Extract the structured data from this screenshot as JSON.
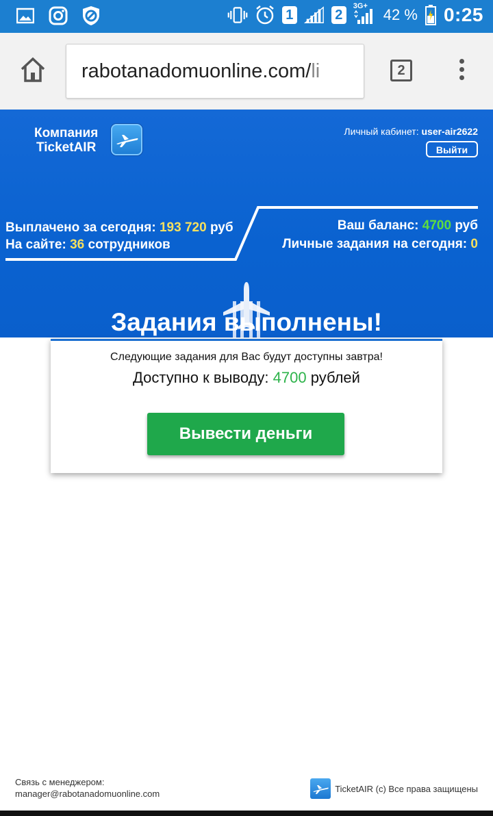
{
  "status_bar": {
    "battery_percent": "42 %",
    "time": "0:25",
    "sim1": "1",
    "sim2": "2",
    "network": "3G+",
    "icons": [
      "gallery-icon",
      "instagram-icon",
      "blocked-icon",
      "vibrate-icon",
      "alarm-icon",
      "signal-icon",
      "battery-icon"
    ]
  },
  "browser": {
    "url_main": "rabotanadomuonline.com/",
    "url_tail": "li",
    "tab_count": "2"
  },
  "header": {
    "logo_line1": "Компания",
    "logo_line2": "TicketAIR",
    "cabinet_label": "Личный кабинет:",
    "cabinet_user": "user-air2622",
    "logout_label": "Выйти"
  },
  "stats": {
    "paid_label": "Выплачено за сегодня:",
    "paid_value": "193 720",
    "paid_unit": "руб",
    "site_label": "На сайте:",
    "site_value": "36",
    "site_unit": "сотрудников",
    "balance_label": "Ваш баланс:",
    "balance_value": "4700",
    "balance_unit": "руб",
    "tasks_label": "Личные задания на сегодня:",
    "tasks_value": "0"
  },
  "hero_title": "Задания выполнены!",
  "card": {
    "note": "Следующие задания для Вас будут доступны завтра!",
    "avail_label": "Доступно к выводу:",
    "avail_value": "4700",
    "avail_unit": "рублей",
    "button_label": "Вывести деньги"
  },
  "footer": {
    "contact_label": "Связь с менеджером:",
    "contact_email": "manager@rabotanadomuonline.com",
    "copyright": "TicketAIR (c) Все права защищены"
  },
  "colors": {
    "header_blue": "#0a62d0",
    "status_blue": "#1c7fd0",
    "accent_yellow": "#f6e05e",
    "accent_green": "#5ede3d",
    "button_green": "#1fa84b"
  }
}
